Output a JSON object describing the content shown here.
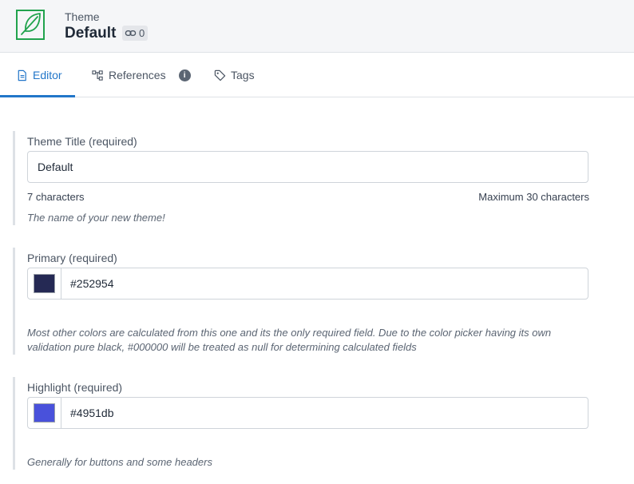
{
  "header": {
    "doc_type": "Theme",
    "title": "Default",
    "references_count": "0",
    "icon": "feather-icon",
    "icon_color": "#21a34d"
  },
  "tabs": [
    {
      "label": "Editor",
      "icon": "document-icon",
      "active": true
    },
    {
      "label": "References",
      "icon": "hierarchy-icon",
      "info": "i"
    },
    {
      "label": "Tags",
      "icon": "tag-icon"
    }
  ],
  "accent_color": "#2276c9",
  "fields": {
    "title": {
      "label": "Theme Title (required)",
      "value": "Default",
      "char_count": "7 characters",
      "max_chars": "Maximum 30 characters",
      "description": "The name of your new theme!"
    },
    "primary": {
      "label": "Primary (required)",
      "value": "#252954",
      "description": "Most other colors are calculated from this one and its the only required field. Due to the color picker having its own validation pure black, #000000 will be treated as null for determining calculated fields"
    },
    "highlight": {
      "label": "Highlight (required)",
      "value": "#4951db",
      "description": "Generally for buttons and some headers"
    }
  }
}
